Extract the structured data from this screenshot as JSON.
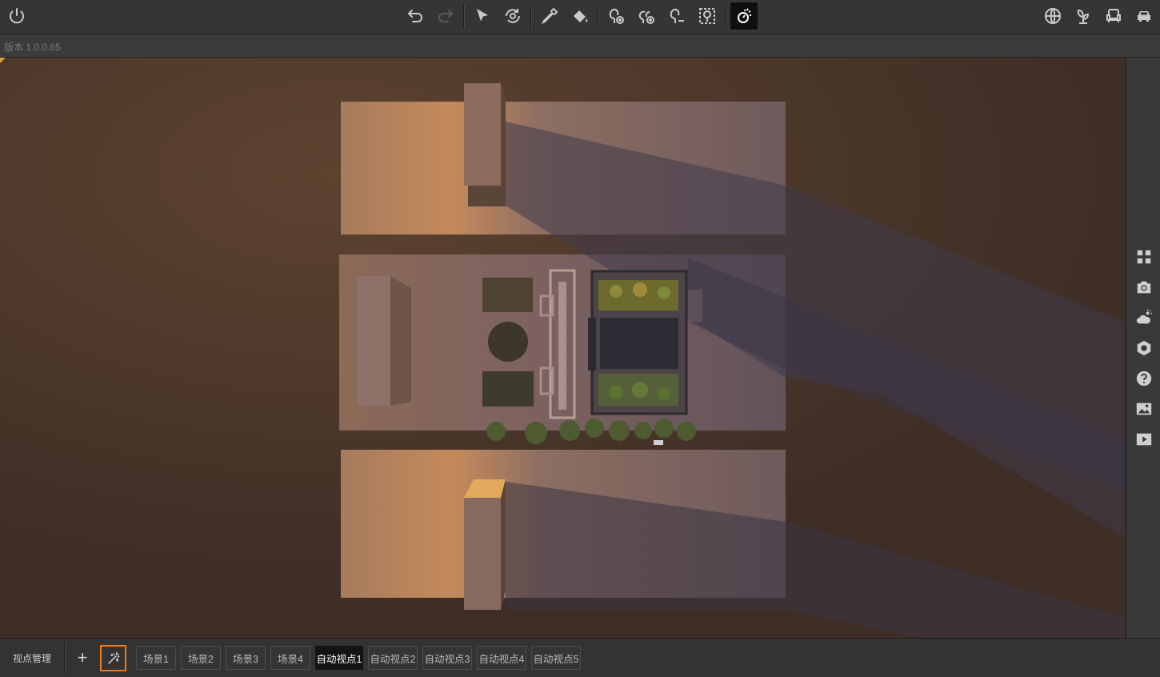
{
  "toolbar": {
    "left": [
      {
        "icon": "power-icon"
      }
    ],
    "center": [
      {
        "icon": "undo-icon",
        "enabled": true
      },
      {
        "icon": "redo-icon",
        "enabled": false
      },
      {
        "icon": "select-arrow-icon"
      },
      {
        "icon": "orbit-icon"
      },
      {
        "icon": "eyedropper-icon"
      },
      {
        "icon": "paint-bucket-icon"
      },
      {
        "icon": "add-tree-icon"
      },
      {
        "icon": "add-trees-icon"
      },
      {
        "icon": "remove-tree-icon"
      },
      {
        "icon": "select-trees-icon"
      },
      {
        "icon": "time-of-day-icon",
        "active": true
      }
    ],
    "right": [
      {
        "icon": "globe-icon"
      },
      {
        "icon": "plant-icon"
      },
      {
        "icon": "armchair-icon"
      },
      {
        "icon": "car-icon"
      }
    ]
  },
  "version": {
    "text": "版本 1.0.0.65"
  },
  "sidebar": {
    "items": [
      {
        "icon": "grid-icon"
      },
      {
        "icon": "camera-icon"
      },
      {
        "icon": "weather-icon"
      },
      {
        "icon": "settings-hex-icon"
      },
      {
        "icon": "help-icon"
      },
      {
        "icon": "image-icon"
      },
      {
        "icon": "play-icon"
      }
    ]
  },
  "bottom": {
    "view_manager": "视点管理",
    "add_label": "+",
    "tabs": [
      {
        "label": "场景1",
        "active": false
      },
      {
        "label": "场景2",
        "active": false
      },
      {
        "label": "场景3",
        "active": false
      },
      {
        "label": "场景4",
        "active": false
      },
      {
        "label": "自动视点1",
        "active": true
      },
      {
        "label": "自动视点2",
        "active": false
      },
      {
        "label": "自动视点3",
        "active": false
      },
      {
        "label": "自动视点4",
        "active": false
      },
      {
        "label": "自动视点5",
        "active": false
      }
    ]
  },
  "colors": {
    "ground": "#463329",
    "accent": "#f07a1a",
    "toolbar": "#353535"
  }
}
